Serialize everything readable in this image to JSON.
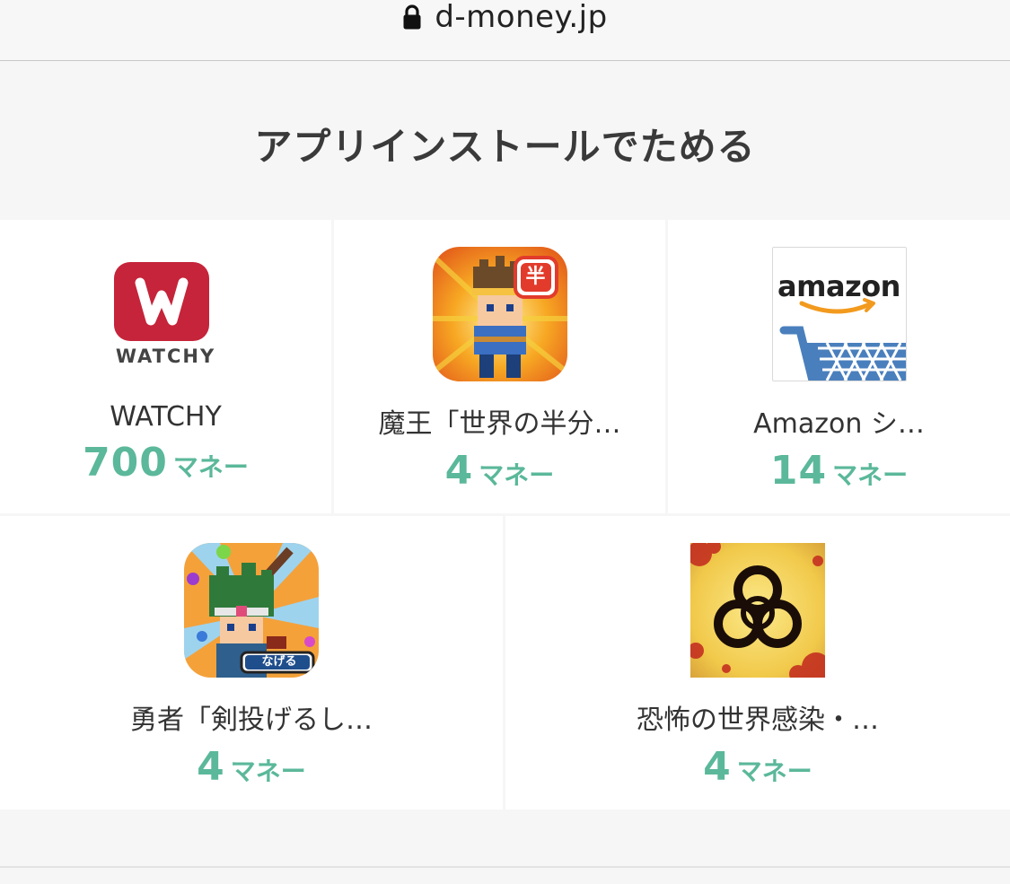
{
  "browser": {
    "url": "d-money.jp",
    "lock_icon": "lock-icon"
  },
  "section": {
    "title": "アプリインストールでためる"
  },
  "apps": [
    {
      "name": "WATCHY",
      "reward": "700",
      "unit": "マネー",
      "icon": "watchy-logo-icon",
      "logo_text": "WATCHY",
      "logo_letter": "W",
      "color": "#c5243a"
    },
    {
      "name": "魔王「世界の半分…",
      "reward": "4",
      "unit": "マネー",
      "icon": "demon-king-game-icon",
      "badge": "半"
    },
    {
      "name": "Amazon シ…",
      "reward": "14",
      "unit": "マネー",
      "icon": "amazon-shopping-icon",
      "logo_text": "amazon"
    },
    {
      "name": "勇者「剣投げるし…",
      "reward": "4",
      "unit": "マネー",
      "icon": "hero-sword-game-icon",
      "badge": "なげる"
    },
    {
      "name": "恐怖の世界感染・…",
      "reward": "4",
      "unit": "マネー",
      "icon": "biohazard-game-icon"
    }
  ],
  "colors": {
    "accent": "#5bb89a",
    "watchy": "#c5243a",
    "amazon_blue": "#4a7fbd",
    "amazon_orange": "#f29a1e"
  }
}
